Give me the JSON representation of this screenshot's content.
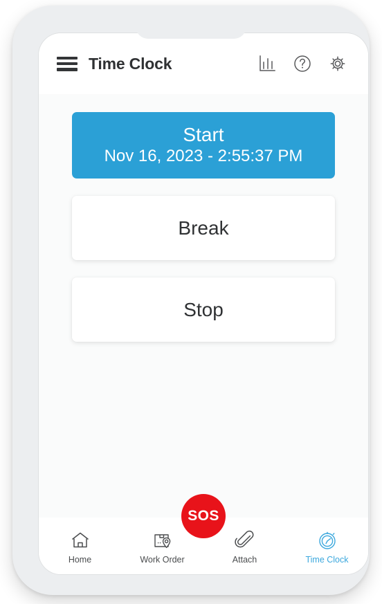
{
  "app": {
    "title": "Time Clock"
  },
  "header": {
    "menu_icon": "hamburger-menu-icon",
    "icons": [
      {
        "name": "bar-chart-icon",
        "label": "Reports"
      },
      {
        "name": "help-circle-icon",
        "label": "Help"
      },
      {
        "name": "gear-icon",
        "label": "Settings"
      }
    ]
  },
  "main": {
    "start_button": {
      "label": "Start",
      "timestamp": "Nov 16, 2023 - 2:55:37 PM",
      "color": "#2ba0d6"
    },
    "break_button": {
      "label": "Break"
    },
    "stop_button": {
      "label": "Stop"
    }
  },
  "sos": {
    "label": "SOS",
    "color": "#e8131a"
  },
  "bottom_nav": {
    "active_color": "#3aa7dd",
    "items": [
      {
        "label": "Home",
        "icon": "home-icon",
        "active": false
      },
      {
        "label": "Work Order",
        "icon": "work-order-box-pin-icon",
        "active": false
      },
      {
        "label": "Attach",
        "icon": "paperclip-icon",
        "active": false
      },
      {
        "label": "Time Clock",
        "icon": "stopwatch-icon",
        "active": true
      }
    ]
  }
}
